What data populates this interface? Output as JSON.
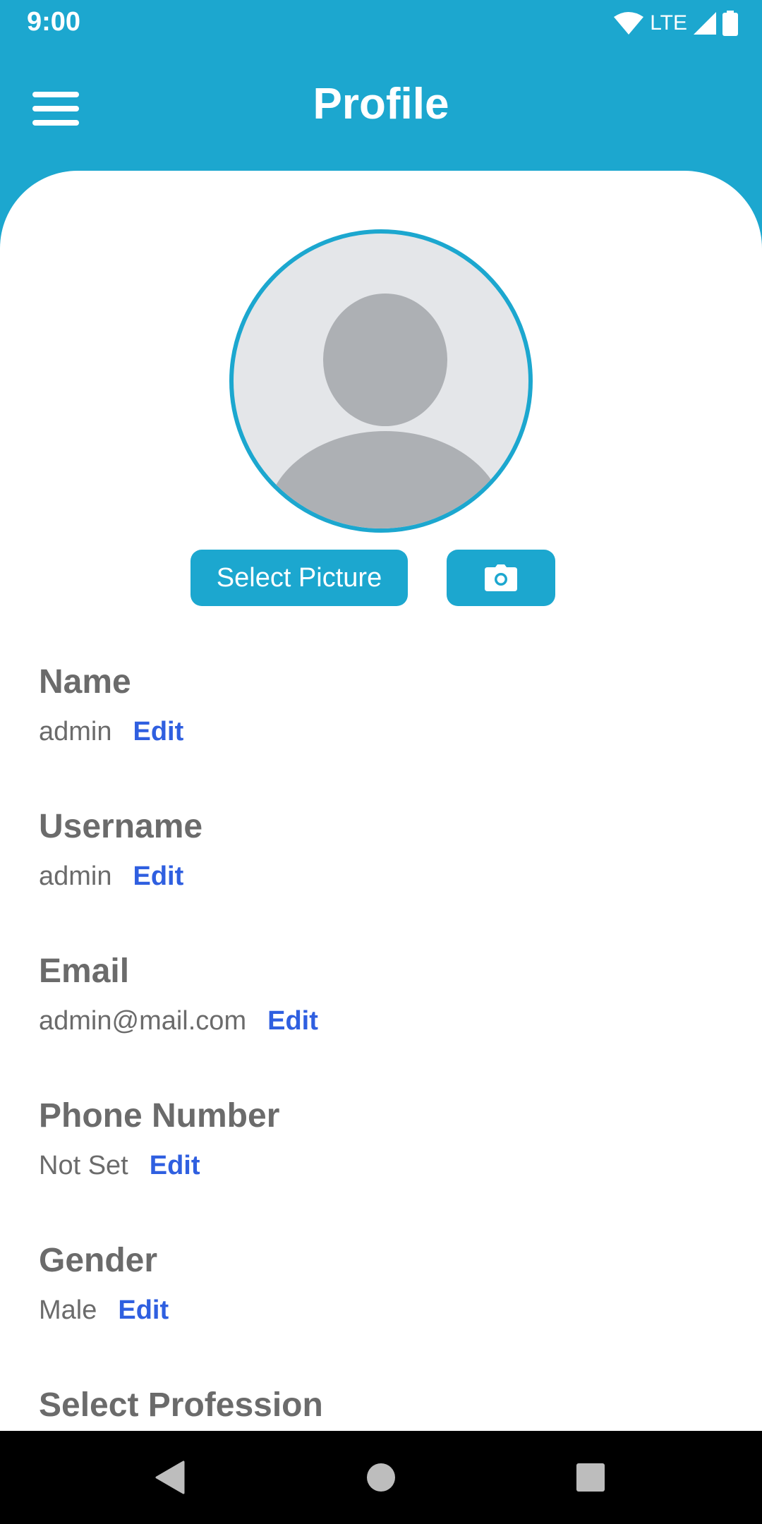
{
  "status_bar": {
    "time": "9:00",
    "network": "LTE",
    "icons": [
      "wifi-icon",
      "signal-icon",
      "battery-icon"
    ]
  },
  "app_bar": {
    "title": "Profile",
    "menu_icon": "menu-icon"
  },
  "profile": {
    "avatar_icon": "default-avatar",
    "select_picture_label": "Select Picture",
    "camera_icon": "camera-icon"
  },
  "fields": [
    {
      "label": "Name",
      "value": "admin",
      "action": "Edit"
    },
    {
      "label": "Username",
      "value": "admin",
      "action": "Edit"
    },
    {
      "label": "Email",
      "value": "admin@mail.com",
      "action": "Edit"
    },
    {
      "label": "Phone Number",
      "value": "Not Set",
      "action": "Edit"
    },
    {
      "label": "Gender",
      "value": "Male",
      "action": "Edit"
    },
    {
      "label": "Select Profession"
    }
  ],
  "nav_bar": {
    "icons": [
      "back-icon",
      "home-icon",
      "recents-icon"
    ]
  },
  "colors": {
    "primary": "#1ca7cf",
    "link": "#2f5fe0",
    "text_muted": "#6b6b6b"
  }
}
